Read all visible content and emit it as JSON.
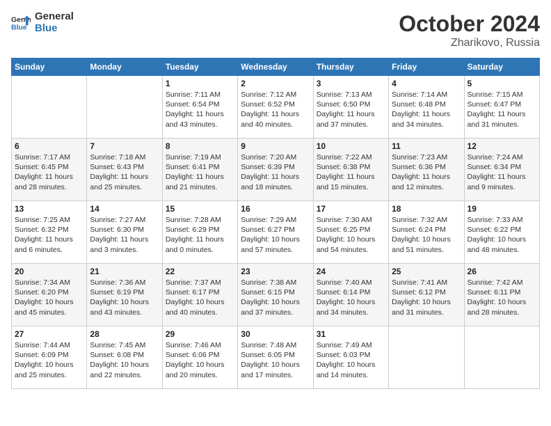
{
  "header": {
    "logo_line1": "General",
    "logo_line2": "Blue",
    "month": "October 2024",
    "location": "Zharikovo, Russia"
  },
  "days_of_week": [
    "Sunday",
    "Monday",
    "Tuesday",
    "Wednesday",
    "Thursday",
    "Friday",
    "Saturday"
  ],
  "weeks": [
    [
      {
        "day": "",
        "info": ""
      },
      {
        "day": "",
        "info": ""
      },
      {
        "day": "1",
        "info": "Sunrise: 7:11 AM\nSunset: 6:54 PM\nDaylight: 11 hours and 43 minutes."
      },
      {
        "day": "2",
        "info": "Sunrise: 7:12 AM\nSunset: 6:52 PM\nDaylight: 11 hours and 40 minutes."
      },
      {
        "day": "3",
        "info": "Sunrise: 7:13 AM\nSunset: 6:50 PM\nDaylight: 11 hours and 37 minutes."
      },
      {
        "day": "4",
        "info": "Sunrise: 7:14 AM\nSunset: 6:48 PM\nDaylight: 11 hours and 34 minutes."
      },
      {
        "day": "5",
        "info": "Sunrise: 7:15 AM\nSunset: 6:47 PM\nDaylight: 11 hours and 31 minutes."
      }
    ],
    [
      {
        "day": "6",
        "info": "Sunrise: 7:17 AM\nSunset: 6:45 PM\nDaylight: 11 hours and 28 minutes."
      },
      {
        "day": "7",
        "info": "Sunrise: 7:18 AM\nSunset: 6:43 PM\nDaylight: 11 hours and 25 minutes."
      },
      {
        "day": "8",
        "info": "Sunrise: 7:19 AM\nSunset: 6:41 PM\nDaylight: 11 hours and 21 minutes."
      },
      {
        "day": "9",
        "info": "Sunrise: 7:20 AM\nSunset: 6:39 PM\nDaylight: 11 hours and 18 minutes."
      },
      {
        "day": "10",
        "info": "Sunrise: 7:22 AM\nSunset: 6:38 PM\nDaylight: 11 hours and 15 minutes."
      },
      {
        "day": "11",
        "info": "Sunrise: 7:23 AM\nSunset: 6:36 PM\nDaylight: 11 hours and 12 minutes."
      },
      {
        "day": "12",
        "info": "Sunrise: 7:24 AM\nSunset: 6:34 PM\nDaylight: 11 hours and 9 minutes."
      }
    ],
    [
      {
        "day": "13",
        "info": "Sunrise: 7:25 AM\nSunset: 6:32 PM\nDaylight: 11 hours and 6 minutes."
      },
      {
        "day": "14",
        "info": "Sunrise: 7:27 AM\nSunset: 6:30 PM\nDaylight: 11 hours and 3 minutes."
      },
      {
        "day": "15",
        "info": "Sunrise: 7:28 AM\nSunset: 6:29 PM\nDaylight: 11 hours and 0 minutes."
      },
      {
        "day": "16",
        "info": "Sunrise: 7:29 AM\nSunset: 6:27 PM\nDaylight: 10 hours and 57 minutes."
      },
      {
        "day": "17",
        "info": "Sunrise: 7:30 AM\nSunset: 6:25 PM\nDaylight: 10 hours and 54 minutes."
      },
      {
        "day": "18",
        "info": "Sunrise: 7:32 AM\nSunset: 6:24 PM\nDaylight: 10 hours and 51 minutes."
      },
      {
        "day": "19",
        "info": "Sunrise: 7:33 AM\nSunset: 6:22 PM\nDaylight: 10 hours and 48 minutes."
      }
    ],
    [
      {
        "day": "20",
        "info": "Sunrise: 7:34 AM\nSunset: 6:20 PM\nDaylight: 10 hours and 45 minutes."
      },
      {
        "day": "21",
        "info": "Sunrise: 7:36 AM\nSunset: 6:19 PM\nDaylight: 10 hours and 43 minutes."
      },
      {
        "day": "22",
        "info": "Sunrise: 7:37 AM\nSunset: 6:17 PM\nDaylight: 10 hours and 40 minutes."
      },
      {
        "day": "23",
        "info": "Sunrise: 7:38 AM\nSunset: 6:15 PM\nDaylight: 10 hours and 37 minutes."
      },
      {
        "day": "24",
        "info": "Sunrise: 7:40 AM\nSunset: 6:14 PM\nDaylight: 10 hours and 34 minutes."
      },
      {
        "day": "25",
        "info": "Sunrise: 7:41 AM\nSunset: 6:12 PM\nDaylight: 10 hours and 31 minutes."
      },
      {
        "day": "26",
        "info": "Sunrise: 7:42 AM\nSunset: 6:11 PM\nDaylight: 10 hours and 28 minutes."
      }
    ],
    [
      {
        "day": "27",
        "info": "Sunrise: 7:44 AM\nSunset: 6:09 PM\nDaylight: 10 hours and 25 minutes."
      },
      {
        "day": "28",
        "info": "Sunrise: 7:45 AM\nSunset: 6:08 PM\nDaylight: 10 hours and 22 minutes."
      },
      {
        "day": "29",
        "info": "Sunrise: 7:46 AM\nSunset: 6:06 PM\nDaylight: 10 hours and 20 minutes."
      },
      {
        "day": "30",
        "info": "Sunrise: 7:48 AM\nSunset: 6:05 PM\nDaylight: 10 hours and 17 minutes."
      },
      {
        "day": "31",
        "info": "Sunrise: 7:49 AM\nSunset: 6:03 PM\nDaylight: 10 hours and 14 minutes."
      },
      {
        "day": "",
        "info": ""
      },
      {
        "day": "",
        "info": ""
      }
    ]
  ]
}
